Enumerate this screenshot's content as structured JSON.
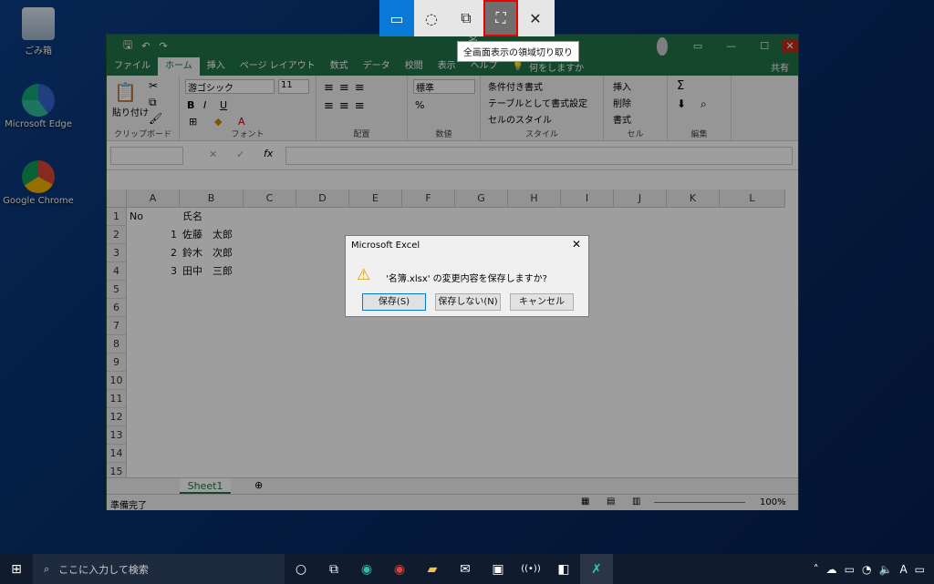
{
  "desktop": {
    "icons": [
      {
        "label": "ごみ箱",
        "name": "recycle-bin"
      },
      {
        "label": "Microsoft Edge",
        "name": "edge"
      },
      {
        "label": "Google Chrome",
        "name": "chrome"
      }
    ]
  },
  "snip": {
    "tooltip": "全画面表示の領域切り取り"
  },
  "excel": {
    "title": "名簿.xlsx",
    "tabs": [
      "ファイル",
      "ホーム",
      "挿入",
      "ページ レイアウト",
      "数式",
      "データ",
      "校閲",
      "表示",
      "ヘルプ"
    ],
    "tellme": "何をしますか",
    "share": "共有",
    "ribbon": {
      "clipboard": "クリップボード",
      "paste": "貼り付け",
      "font_group": "フォント",
      "font_name": "游ゴシック",
      "font_size": "11",
      "align": "配置",
      "number": "数値",
      "number_format": "標準",
      "styles": "スタイル",
      "cond": "条件付き書式",
      "table": "テーブルとして書式設定",
      "cellstyle": "セルのスタイル",
      "cells": "セル",
      "insert": "挿入",
      "delete": "削除",
      "format": "書式",
      "edit": "編集"
    },
    "fx": "fx",
    "columns": [
      "A",
      "B",
      "C",
      "D",
      "E",
      "F",
      "G",
      "H",
      "I",
      "J",
      "K",
      "L"
    ],
    "rows": [
      "1",
      "2",
      "3",
      "4",
      "5",
      "6",
      "7",
      "8",
      "9",
      "10",
      "11",
      "12",
      "13",
      "14",
      "15"
    ],
    "data": {
      "a1": "No",
      "b1": "氏名",
      "a2": "1",
      "b2": "佐藤　太郎",
      "a3": "2",
      "b3": "鈴木　次郎",
      "a4": "3",
      "b4": "田中　三郎"
    },
    "sheet": "Sheet1",
    "status": "準備完了",
    "zoom": "100%"
  },
  "dialog": {
    "title": "Microsoft Excel",
    "message": "'名簿.xlsx' の変更内容を保存しますか?",
    "save": "保存(S)",
    "nosave": "保存しない(N)",
    "cancel": "キャンセル"
  },
  "taskbar": {
    "search": "ここに入力して検索"
  }
}
